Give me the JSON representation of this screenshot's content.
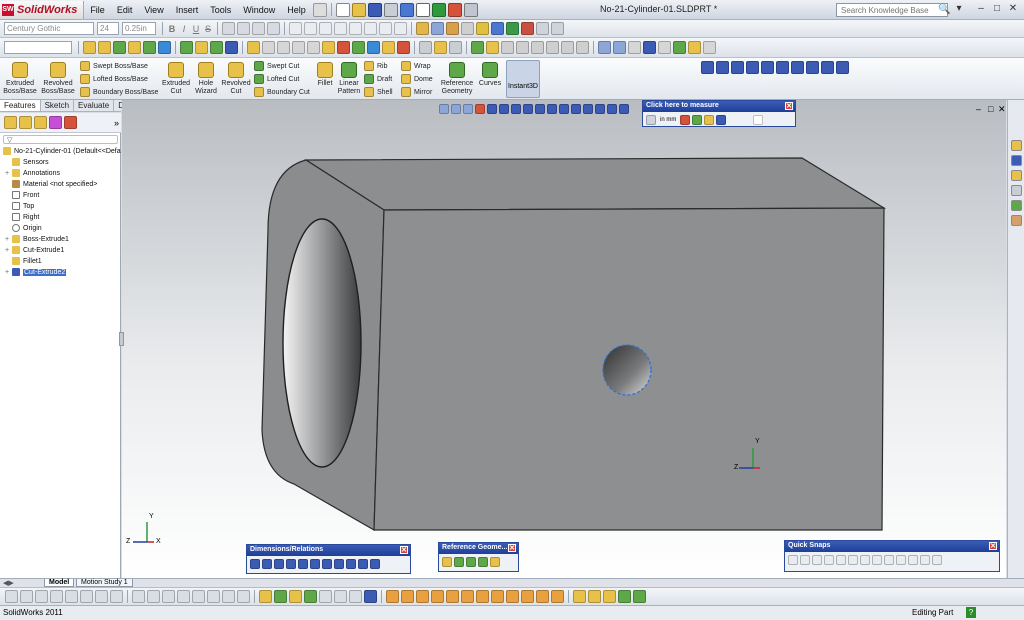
{
  "app": {
    "name": "SolidWorks",
    "logo_text": "SW",
    "document_title": "No-21-Cylinder-01.SLDPRT *"
  },
  "menu": [
    "File",
    "Edit",
    "View",
    "Insert",
    "Tools",
    "Window",
    "Help"
  ],
  "search": {
    "placeholder": "Search Knowledge Base"
  },
  "format_bar": {
    "font": "Century Gothic",
    "size": "24",
    "height": "0.25in",
    "bold": "B",
    "italic": "I",
    "underline": "U",
    "strike": "S"
  },
  "command_manager": {
    "extruded_boss": "Extruded Boss/Base",
    "revolved_boss": "Revolved Boss/Base",
    "swept_boss": "Swept Boss/Base",
    "lofted_boss": "Lofted Boss/Base",
    "boundary_boss": "Boundary Boss/Base",
    "extruded_cut": "Extruded Cut",
    "hole_wizard": "Hole Wizard",
    "revolved_cut": "Revolved Cut",
    "swept_cut": "Swept Cut",
    "lofted_cut": "Lofted Cut",
    "boundary_cut": "Boundary Cut",
    "fillet": "Fillet",
    "linear_pattern": "Linear Pattern",
    "rib": "Rib",
    "draft": "Draft",
    "shell": "Shell",
    "wrap": "Wrap",
    "dome": "Dome",
    "mirror": "Mirror",
    "reference_geometry": "Reference Geometry",
    "curves": "Curves",
    "instant3d": "Instant3D"
  },
  "manager_tabs": [
    "Features",
    "Sketch",
    "Evaluate",
    "DimXpert"
  ],
  "tree": {
    "root": "No-21-Cylinder-01  (Default<<Defa",
    "items": [
      "Sensors",
      "Annotations",
      "Material <not specified>",
      "Front",
      "Top",
      "Right",
      "Origin",
      "Boss-Extrude1",
      "Cut-Extrude1",
      "Fillet1",
      "Cut-Extrude2"
    ]
  },
  "measure_panel": {
    "title": "Click here to measure",
    "unit": "in mm"
  },
  "panels": {
    "dimensions": "Dimensions/Relations",
    "reference_geometry": "Reference Geome...",
    "quick_snaps": "Quick Snaps"
  },
  "triad": {
    "x": "X",
    "y": "Y",
    "z": "Z"
  },
  "bottom_tabs": [
    "Model",
    "Motion Study 1"
  ],
  "status": {
    "left": "SolidWorks 2011",
    "right": "Editing Part",
    "help": "?"
  },
  "colors": {
    "accent": "#1e3f96",
    "logo": "#c8102e",
    "part": "#8a8b8c",
    "selection": "#3d6fc8"
  }
}
